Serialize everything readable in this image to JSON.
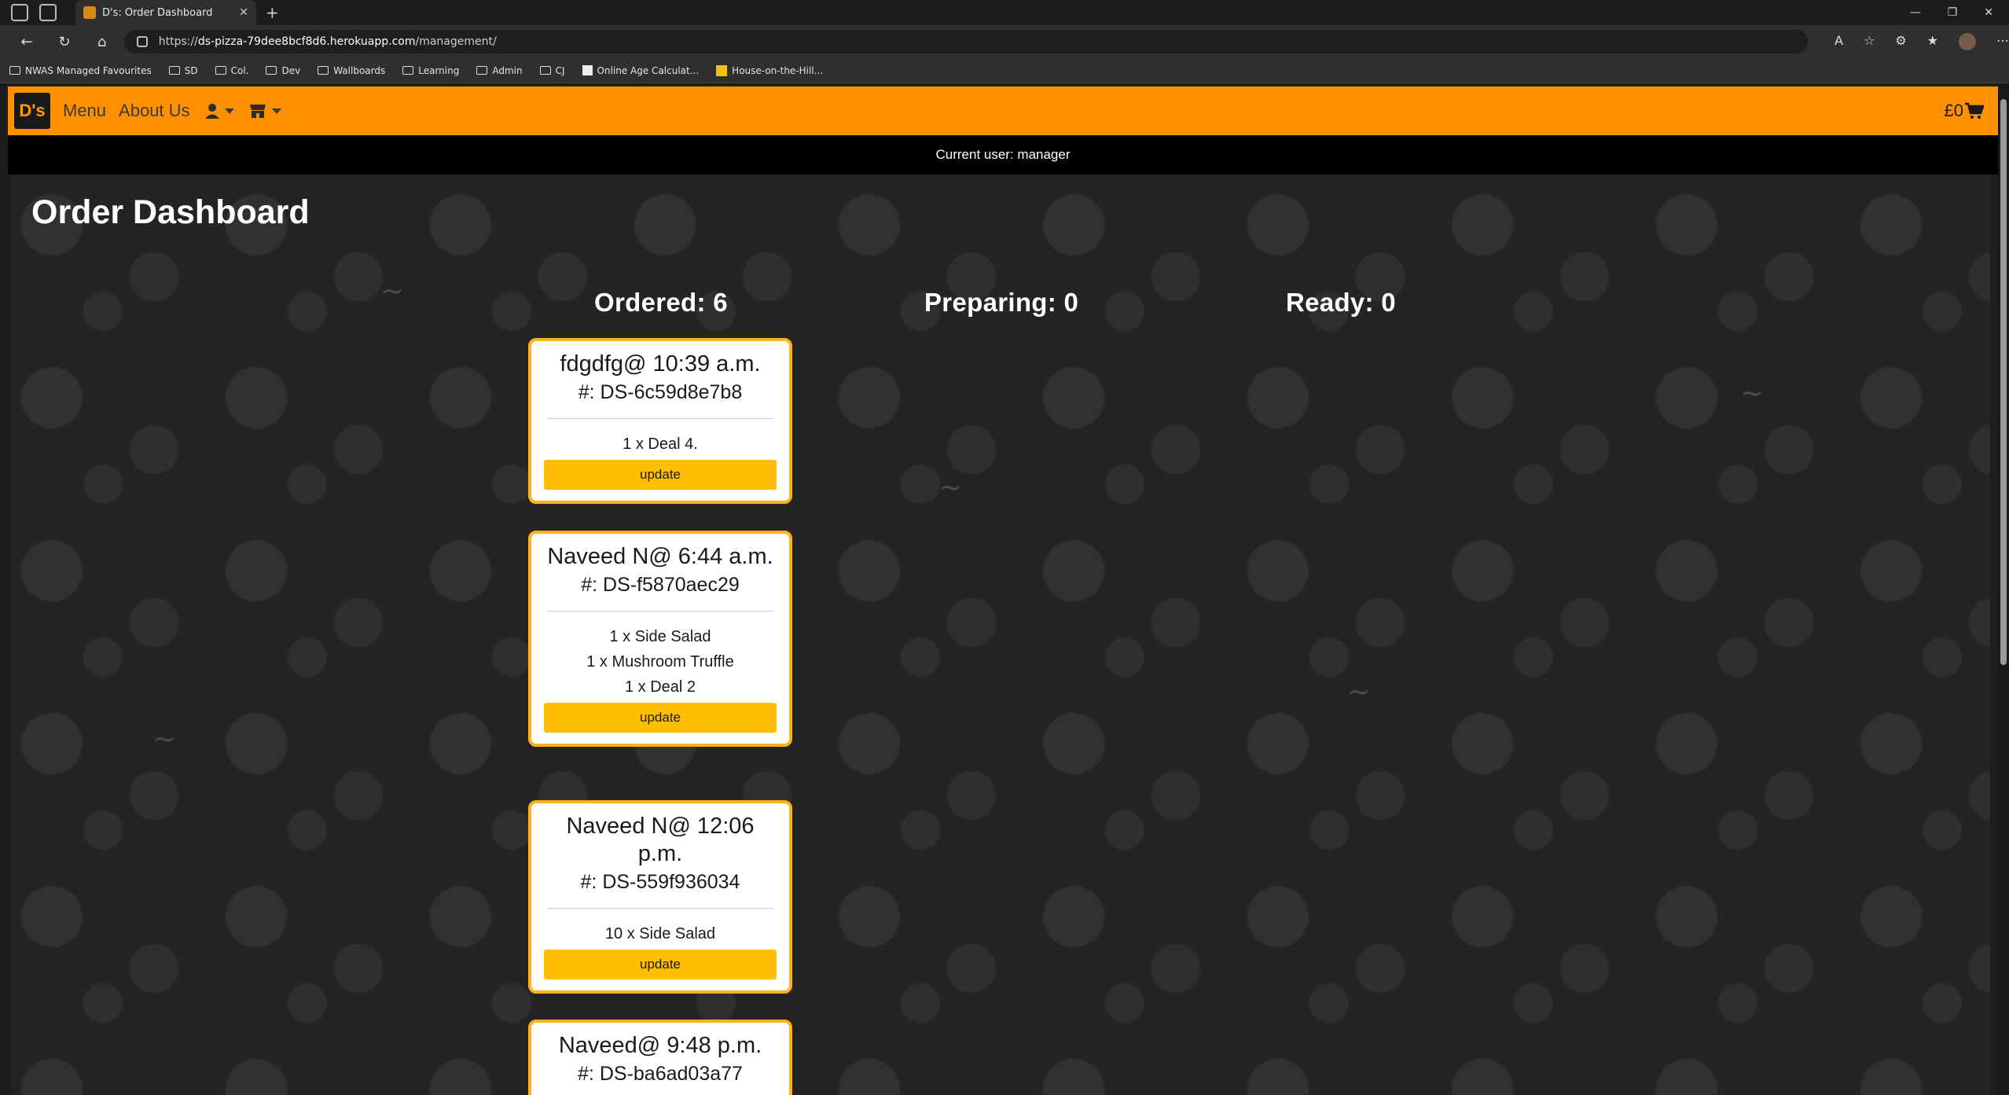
{
  "browser": {
    "tab_title": "D's: Order Dashboard",
    "url_prefix": "https://",
    "url_host": "ds-pizza-79dee8bcf8d6.herokuapp.com",
    "url_path": "/management/",
    "bookmarks": [
      "NWAS Managed Favourites",
      "SD",
      "Col.",
      "Dev",
      "Wallboards",
      "Learning",
      "Admin",
      "CJ",
      "Online Age Calculat...",
      "House-on-the-Hill..."
    ]
  },
  "navbar": {
    "logo": "D's",
    "menu_label": "Menu",
    "about_label": "About Us",
    "cart_total": "£0",
    "accent": "#ff9100"
  },
  "userbar": {
    "text": "Current user: manager"
  },
  "page": {
    "title": "Order Dashboard"
  },
  "status": {
    "ordered": "Ordered: 6",
    "preparing": "Preparing: 0",
    "ready": "Ready: 0"
  },
  "orders": [
    {
      "title": "fdgdfg@ 10:39 a.m.",
      "id": "#: DS-6c59d8e7b8",
      "items": [
        "1 x Deal 4."
      ],
      "button": "update"
    },
    {
      "title": "Naveed N@ 6:44 a.m.",
      "id": "#: DS-f5870aec29",
      "items": [
        "1 x Side Salad",
        "1 x Mushroom Truffle",
        "1 x Deal 2"
      ],
      "button": "update"
    },
    {
      "title": "Naveed N@ 12:06 p.m.",
      "id": "#: DS-559f936034",
      "items": [
        "10 x Side Salad"
      ],
      "button": "update"
    },
    {
      "title": "Naveed@ 9:48 p.m.",
      "id": "#: DS-ba6ad03a77",
      "items": [],
      "button": ""
    }
  ]
}
